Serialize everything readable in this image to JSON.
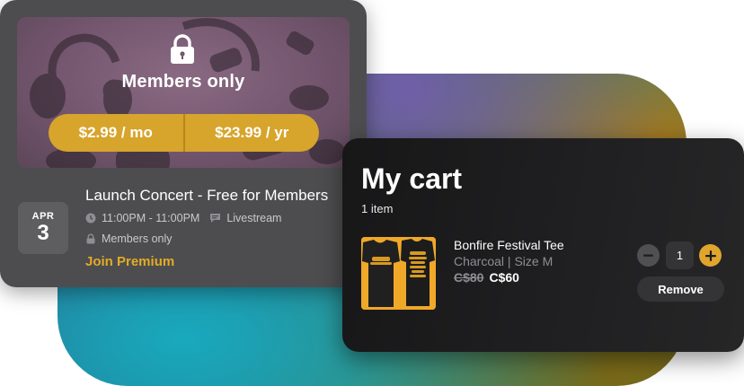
{
  "membership": {
    "title": "Members only",
    "monthly_price": "$2.99 / mo",
    "yearly_price": "$23.99 / yr"
  },
  "event": {
    "month": "APR",
    "day": "3",
    "title": "Launch Concert - Free for Members",
    "time": "11:00PM - 11:00PM",
    "location": "Livestream",
    "access": "Members only",
    "cta": "Join Premium"
  },
  "cart": {
    "title": "My cart",
    "count": "1 item",
    "item": {
      "name": "Bonfire Festival Tee",
      "variant": "Charcoal | Size M",
      "old_price": "C$80",
      "price": "C$60",
      "quantity": "1"
    },
    "remove_label": "Remove"
  },
  "colors": {
    "accent": "#e0a52d",
    "card": "#4d4d4f",
    "cart_bg": "#1d1d1f"
  },
  "icons": {
    "lock": "lock-icon",
    "clock": "clock-icon",
    "stream": "chat-bubble-icon",
    "small_lock": "lock-icon",
    "minus": "minus-icon",
    "plus": "plus-icon"
  }
}
